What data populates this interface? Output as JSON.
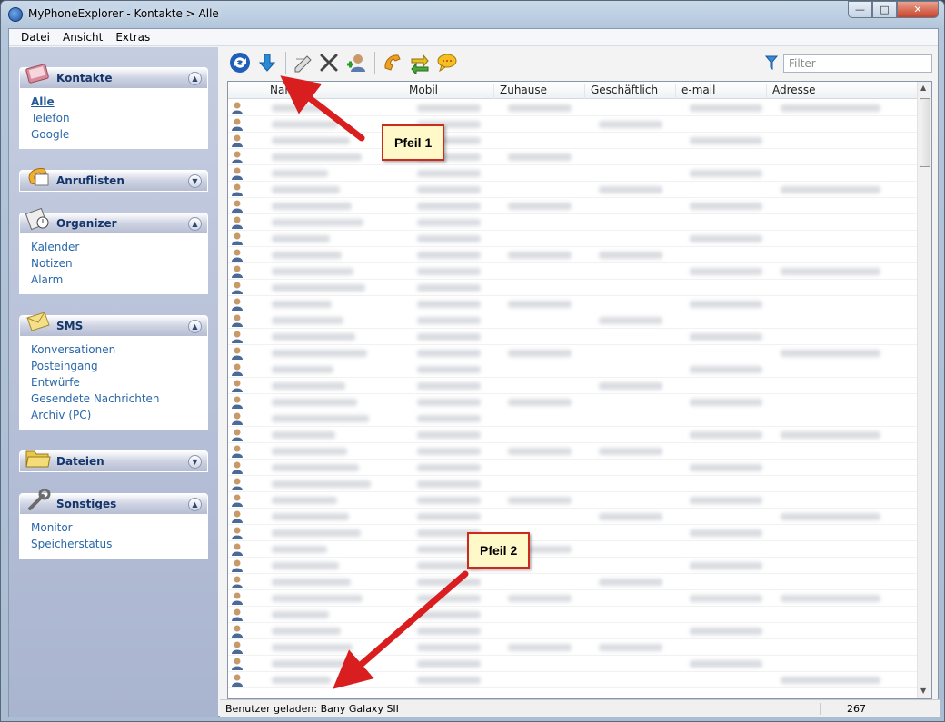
{
  "window": {
    "title": "MyPhoneExplorer -  Kontakte > Alle"
  },
  "menu": [
    "Datei",
    "Ansicht",
    "Extras"
  ],
  "sidebar": [
    {
      "title": "Kontakte",
      "icon": "contacts-book-icon",
      "expanded": true,
      "items": [
        "Alle",
        "Telefon",
        "Google"
      ],
      "active": "Alle"
    },
    {
      "title": "Anruflisten",
      "icon": "phone-icon",
      "expanded": false,
      "items": []
    },
    {
      "title": "Organizer",
      "icon": "calendar-clock-icon",
      "expanded": true,
      "items": [
        "Kalender",
        "Notizen",
        "Alarm"
      ]
    },
    {
      "title": "SMS",
      "icon": "envelope-icon",
      "expanded": true,
      "items": [
        "Konversationen",
        "Posteingang",
        "Entwürfe",
        "Gesendete Nachrichten",
        "Archiv (PC)"
      ]
    },
    {
      "title": "Dateien",
      "icon": "folder-icon",
      "expanded": false,
      "items": []
    },
    {
      "title": "Sonstiges",
      "icon": "wrench-icon",
      "expanded": true,
      "items": [
        "Monitor",
        "Speicherstatus"
      ]
    }
  ],
  "toolbar": {
    "buttons": [
      "refresh-icon",
      "download-arrow-icon",
      "edit-icon",
      "delete-icon",
      "add-contact-icon",
      "call-icon",
      "sync-icon",
      "message-icon"
    ],
    "filter_placeholder": "Filter"
  },
  "grid": {
    "columns": [
      "Name",
      "Mobil",
      "Zuhause",
      "Geschäftlich",
      "e-mail",
      "Adresse"
    ],
    "row_count": 36
  },
  "status": {
    "text": "Benutzer geladen: Bany Galaxy SII",
    "count": "267"
  },
  "annotations": {
    "callout1": "Pfeil 1",
    "callout2": "Pfeil 2"
  },
  "colors": {
    "link": "#2a68a8",
    "arrow": "#d81e1e"
  }
}
